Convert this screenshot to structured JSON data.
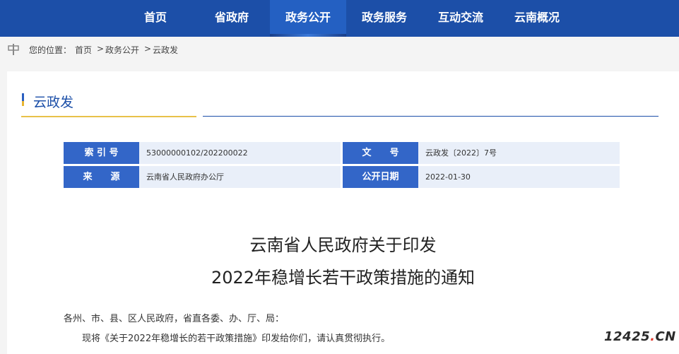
{
  "nav": {
    "items": [
      {
        "label": "首页"
      },
      {
        "label": "省政府"
      },
      {
        "label": "政务公开"
      },
      {
        "label": "政务服务"
      },
      {
        "label": "互动交流"
      },
      {
        "label": "云南概况"
      }
    ],
    "active_index": 2
  },
  "breadcrumb": {
    "prefix": "您的位置：",
    "items": [
      "首页",
      "政务公开",
      "云政发"
    ],
    "separator": ">"
  },
  "section": {
    "title": "云政发"
  },
  "meta": {
    "index_no_label": "索 引 号",
    "index_no_value": "53000000102/202200022",
    "doc_no_label": "文　　号",
    "doc_no_value": "云政发〔2022〕7号",
    "source_label": "来　　源",
    "source_value": "云南省人民政府办公厅",
    "publish_date_label": "公开日期",
    "publish_date_value": "2022-01-30"
  },
  "document": {
    "title_line1": "云南省人民政府关于印发",
    "title_line2": "2022年稳增长若干政策措施的通知",
    "salutation": "各州、市、县、区人民政府，省直各委、办、厅、局：",
    "body": "现将《关于2022年稳增长的若干政策措施》印发给你们，请认真贯彻执行。"
  },
  "watermark": {
    "text_main": "12425",
    "text_dot": ".",
    "text_tail": "CN"
  },
  "colors": {
    "nav_bg": "#1c4fa8",
    "label_bg": "#3366c8",
    "value_bg": "#e9eff9",
    "gold": "#e8c24a"
  }
}
